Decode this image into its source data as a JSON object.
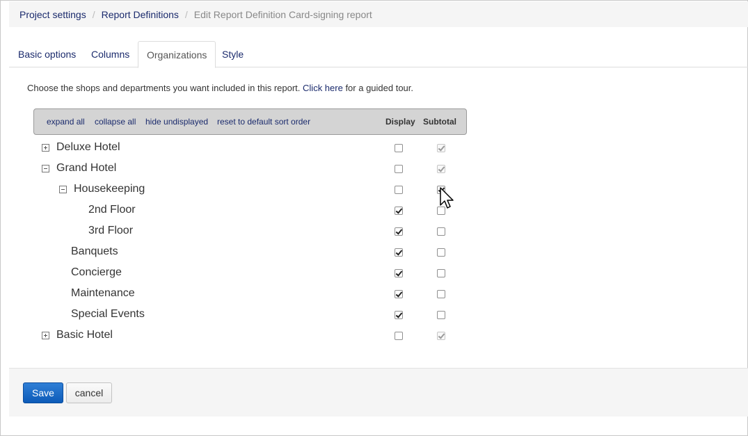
{
  "breadcrumb": {
    "items": [
      "Project settings",
      "Report Definitions"
    ],
    "separator": "/",
    "current": "Edit Report Definition Card-signing report"
  },
  "tabs": [
    {
      "label": "Basic options",
      "active": false
    },
    {
      "label": "Columns",
      "active": false
    },
    {
      "label": "Organizations",
      "active": true
    },
    {
      "label": "Style",
      "active": false
    }
  ],
  "intro": {
    "before": "Choose the shops and departments you want included in this report. ",
    "link": "Click here",
    "after": " for a guided tour."
  },
  "toolbar": {
    "expand_all": "expand all",
    "collapse_all": "collapse all",
    "hide_undisplayed": "hide undisplayed",
    "reset_sort": "reset to default sort order",
    "display_header": "Display",
    "subtotal_header": "Subtotal"
  },
  "tree": [
    {
      "label": "Deluxe Hotel",
      "level": 0,
      "toggle": "expand",
      "display": false,
      "subtotal": true,
      "subtotal_disabled": true
    },
    {
      "label": "Grand Hotel",
      "level": 0,
      "toggle": "collapse",
      "display": false,
      "subtotal": true,
      "subtotal_disabled": true
    },
    {
      "label": "Housekeeping",
      "level": 1,
      "toggle": "collapse",
      "display": false,
      "subtotal": true,
      "subtotal_disabled": false
    },
    {
      "label": "2nd Floor",
      "level": 2,
      "toggle": "none",
      "display": true,
      "subtotal": false,
      "subtotal_disabled": false
    },
    {
      "label": "3rd Floor",
      "level": 2,
      "toggle": "none",
      "display": true,
      "subtotal": false,
      "subtotal_disabled": false
    },
    {
      "label": "Banquets",
      "level": 1,
      "toggle": "none",
      "display": true,
      "subtotal": false,
      "subtotal_disabled": false
    },
    {
      "label": "Concierge",
      "level": 1,
      "toggle": "none",
      "display": true,
      "subtotal": false,
      "subtotal_disabled": false
    },
    {
      "label": "Maintenance",
      "level": 1,
      "toggle": "none",
      "display": true,
      "subtotal": false,
      "subtotal_disabled": false
    },
    {
      "label": "Special Events",
      "level": 1,
      "toggle": "none",
      "display": true,
      "subtotal": false,
      "subtotal_disabled": false
    },
    {
      "label": "Basic Hotel",
      "level": 0,
      "toggle": "expand",
      "display": false,
      "subtotal": true,
      "subtotal_disabled": true
    }
  ],
  "footer": {
    "save_label": "Save",
    "cancel_label": "cancel"
  },
  "colors": {
    "link": "#1a2a6c",
    "primary_button": "#1565c0",
    "toolbar_bg": "#d4d4d4",
    "breadcrumb_bg": "#f5f5f5"
  }
}
